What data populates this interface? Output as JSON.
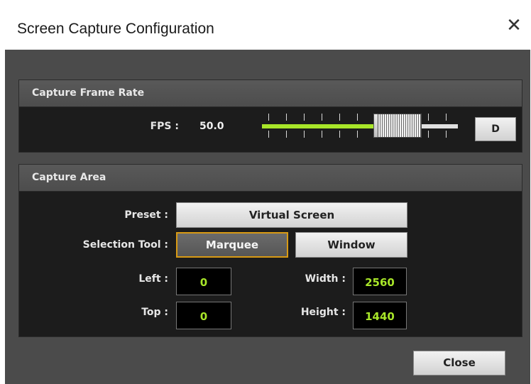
{
  "window": {
    "title": "Screen Capture Configuration",
    "close_glyph": "✕"
  },
  "frame_rate": {
    "title": "Capture Frame Rate",
    "fps_label": "FPS :",
    "fps_value": "50.0",
    "slider_level": 0.72,
    "default_button": "D",
    "accent_color": "#a8e629"
  },
  "capture_area": {
    "title": "Capture Area",
    "preset_label": "Preset :",
    "preset_value": "Virtual Screen",
    "selection_tool_label": "Selection Tool :",
    "marquee_button": "Marquee",
    "window_button": "Window",
    "left_label": "Left :",
    "left_value": "0",
    "top_label": "Top :",
    "top_value": "0",
    "width_label": "Width :",
    "width_value": "2560",
    "height_label": "Height :",
    "height_value": "1440"
  },
  "footer": {
    "close_button": "Close"
  }
}
